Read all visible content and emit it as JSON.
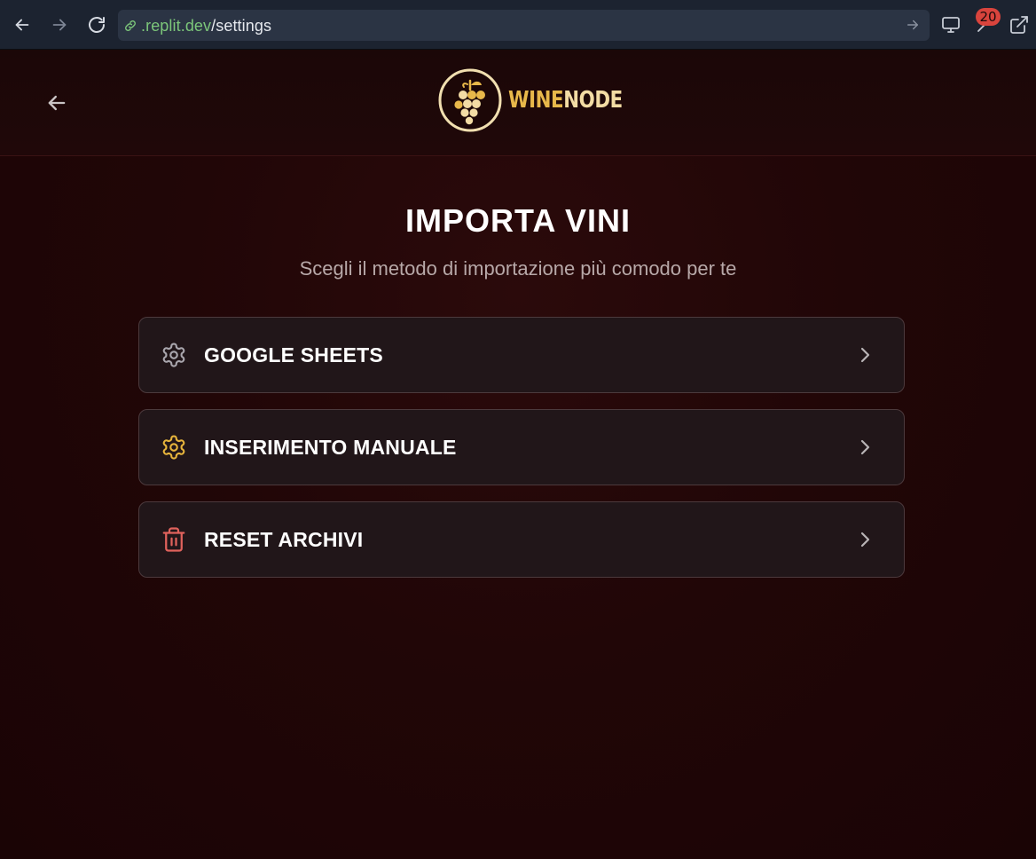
{
  "browser": {
    "url_host": ".replit.dev",
    "url_path": "/settings",
    "badge_count": "20"
  },
  "header": {
    "logo_wine": "WINE",
    "logo_node": "NODE"
  },
  "main": {
    "title": "IMPORTA VINI",
    "subtitle": "Scegli il metodo di importazione più comodo per te",
    "options": [
      {
        "label": "GOOGLE SHEETS",
        "icon": "gear-icon",
        "icon_color": "#a9a6ad"
      },
      {
        "label": "INSERIMENTO MANUALE",
        "icon": "gear-icon",
        "icon_color": "#e6b43c"
      },
      {
        "label": "RESET ARCHIVI",
        "icon": "trash-icon",
        "icon_color": "#e0625c"
      }
    ]
  },
  "colors": {
    "accent_gold": "#e8b84a",
    "danger": "#e0625c",
    "background": "#210607"
  }
}
